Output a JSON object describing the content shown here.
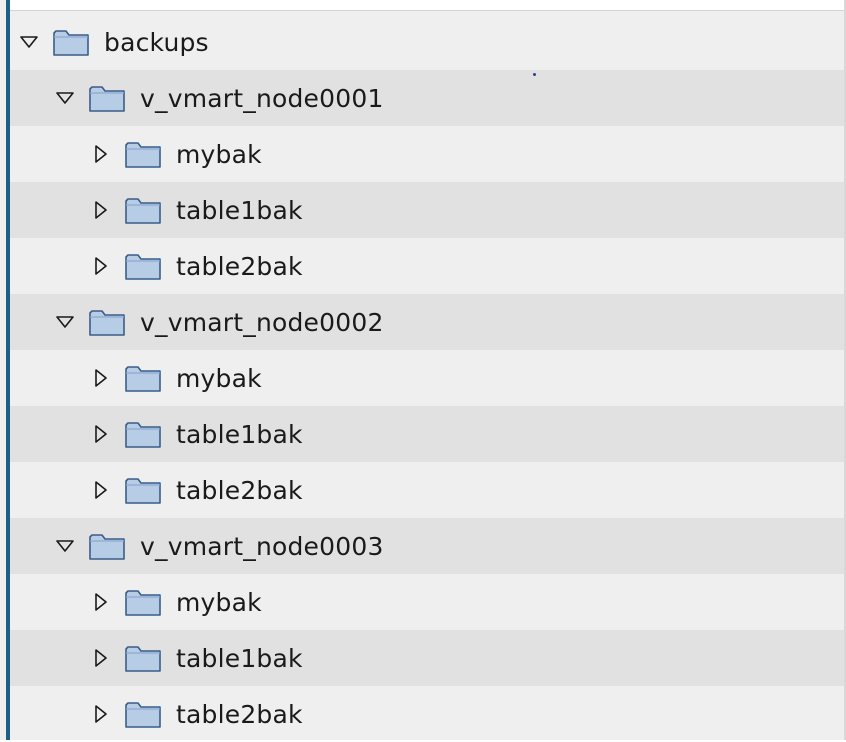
{
  "tree": {
    "root": {
      "label": "backups",
      "expanded": true,
      "icon": "folder-icon",
      "children": [
        {
          "label": "v_vmart_node0001",
          "expanded": true,
          "icon": "folder-icon",
          "children": [
            {
              "label": "mybak",
              "expanded": false,
              "icon": "folder-icon"
            },
            {
              "label": "table1bak",
              "expanded": false,
              "icon": "folder-icon"
            },
            {
              "label": "table2bak",
              "expanded": false,
              "icon": "folder-icon"
            }
          ]
        },
        {
          "label": "v_vmart_node0002",
          "expanded": true,
          "icon": "folder-icon",
          "children": [
            {
              "label": "mybak",
              "expanded": false,
              "icon": "folder-icon"
            },
            {
              "label": "table1bak",
              "expanded": false,
              "icon": "folder-icon"
            },
            {
              "label": "table2bak",
              "expanded": false,
              "icon": "folder-icon"
            }
          ]
        },
        {
          "label": "v_vmart_node0003",
          "expanded": true,
          "icon": "folder-icon",
          "children": [
            {
              "label": "mybak",
              "expanded": false,
              "icon": "folder-icon"
            },
            {
              "label": "table1bak",
              "expanded": false,
              "icon": "folder-icon"
            },
            {
              "label": "table2bak",
              "expanded": false,
              "icon": "folder-icon"
            }
          ]
        }
      ]
    }
  },
  "colors": {
    "row_background": "#efefef",
    "row_alt_background": "#e1e1e1",
    "left_border": "#1d5f86",
    "folder_fill": "#b7cde6",
    "folder_stroke": "#3a5d8a",
    "text": "#1a1a1a"
  }
}
